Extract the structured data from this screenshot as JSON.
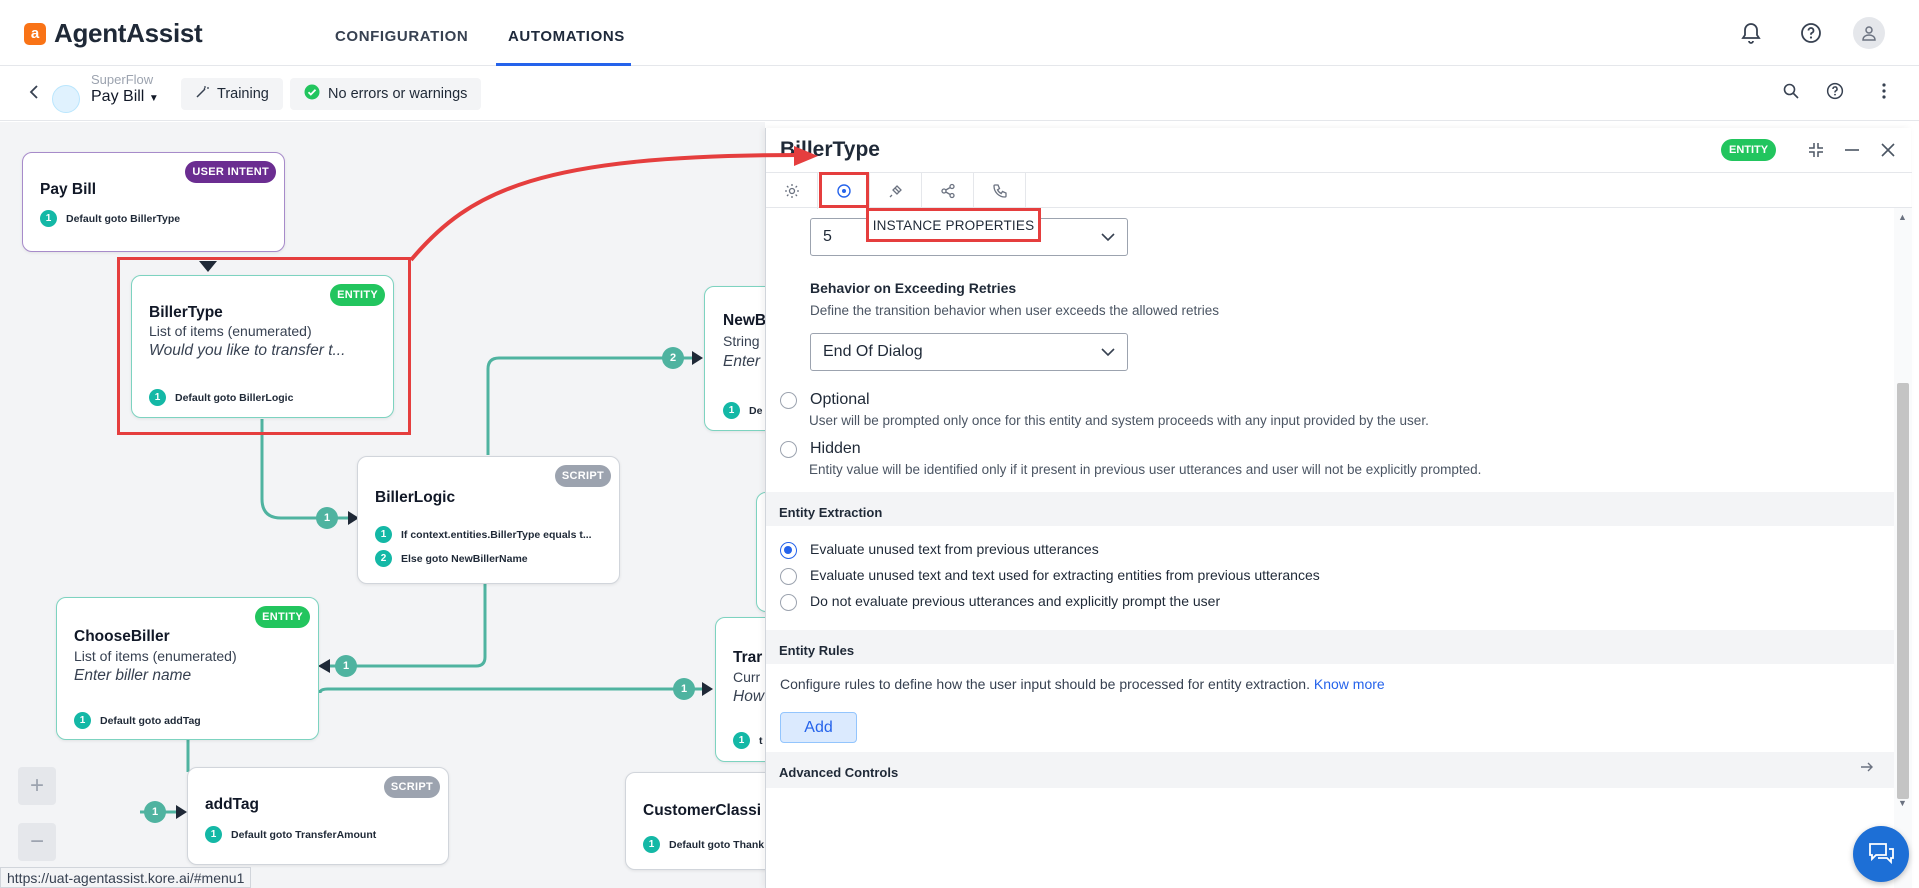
{
  "app": {
    "logo_letter": "a",
    "name": "AgentAssist"
  },
  "nav": {
    "configuration": "CONFIGURATION",
    "automations": "AUTOMATIONS"
  },
  "subbar": {
    "flow_type": "SuperFlow",
    "flow_name": "Pay Bill",
    "training": "Training",
    "status": "No errors or warnings"
  },
  "nodes": {
    "paybill": {
      "title": "Pay Bill",
      "badge": "USER INTENT",
      "rule_num": "1",
      "rule": "Default goto BillerType"
    },
    "billertype": {
      "title": "BillerType",
      "badge": "ENTITY",
      "sub": "List of items (enumerated)",
      "prompt": "Would you like to transfer t...",
      "rule_num": "1",
      "rule": "Default goto BillerLogic"
    },
    "newbiller": {
      "title": "NewB",
      "sub": "String",
      "prompt": "Enter",
      "rule_num": "1",
      "rule": "De"
    },
    "billerlogic": {
      "title": "BillerLogic",
      "badge": "SCRIPT",
      "rule1_num": "1",
      "rule1": "If context.entities.BillerType equals t...",
      "rule2_num": "2",
      "rule2": "Else goto NewBillerName"
    },
    "choosebiller": {
      "title": "ChooseBiller",
      "badge": "ENTITY",
      "sub": "List of items (enumerated)",
      "prompt": "Enter biller name",
      "rule_num": "1",
      "rule": "Default goto addTag"
    },
    "transfer": {
      "title": "Trar",
      "sub": "Curr",
      "prompt": "How",
      "rule_num": "1",
      "rule": "t"
    },
    "addtag": {
      "title": "addTag",
      "badge": "SCRIPT",
      "rule_num": "1",
      "rule": "Default goto TransferAmount"
    },
    "customer": {
      "title": "CustomerClassi",
      "rule_num": "1",
      "rule": "Default goto Thank"
    }
  },
  "edges": {
    "e1": "1",
    "e2": "2",
    "e3": "1",
    "e4": "1",
    "e5": "1"
  },
  "zoom": {
    "in": "+",
    "out": "−"
  },
  "panel": {
    "title": "BillerType",
    "badge": "ENTITY",
    "tooltip": "INSTANCE PROPERTIES",
    "retries_value": "5",
    "behavior_label": "Behavior on Exceeding Retries",
    "behavior_desc": "Define the transition behavior when user exceeds the allowed retries",
    "behavior_value": "End Of Dialog",
    "optional_label": "Optional",
    "optional_desc": "User will be prompted only once for this entity and system proceeds with any input provided by the user.",
    "hidden_label": "Hidden",
    "hidden_desc": "Entity value will be identified only if it present in previous user utterances and user will not be explicitly prompted.",
    "extraction_header": "Entity Extraction",
    "extraction_opts": [
      "Evaluate unused text from previous utterances",
      "Evaluate unused text and text used for extracting entities from previous utterances",
      "Do not evaluate previous utterances and explicitly prompt the user"
    ],
    "rules_header": "Entity Rules",
    "rules_desc": "Configure rules to define how the user input should be processed for entity extraction.",
    "know_more": "Know more",
    "add": "Add",
    "advanced": "Advanced Controls"
  },
  "statusbar": "https://uat-agentassist.kore.ai/#menu1",
  "colors": {
    "brand": "#f97316",
    "accent": "#2563eb",
    "teal": "#14b8a6",
    "entity": "#22c55e",
    "intent": "#6b2d91",
    "highlight": "#e53e3e"
  }
}
